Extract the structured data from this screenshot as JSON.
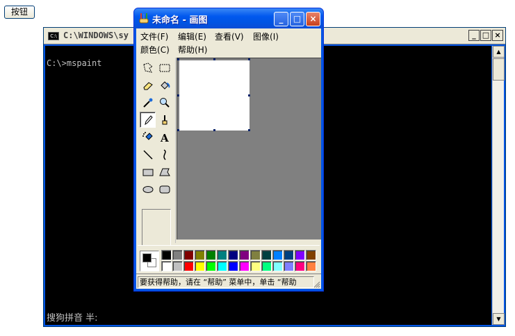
{
  "page_button": {
    "label": "按钮"
  },
  "console": {
    "title": "C:\\WINDOWS\\sy",
    "icon_label": "C:\\",
    "controls": [
      "_",
      "□",
      "×"
    ],
    "prompt_line": "C:\\>mspaint",
    "ime_status": "搜狗拼音 半:"
  },
  "paint": {
    "title": "未命名 - 画图",
    "controls": [
      "_",
      "□",
      "×"
    ],
    "menus": [
      {
        "label": "文件",
        "hotkey": "(F)"
      },
      {
        "label": "编辑",
        "hotkey": "(E)"
      },
      {
        "label": "查看",
        "hotkey": "(V)"
      },
      {
        "label": "图像",
        "hotkey": "(I)"
      },
      {
        "label": "颜色",
        "hotkey": "(C)"
      },
      {
        "label": "帮助",
        "hotkey": "(H)"
      }
    ],
    "tools": [
      "free-select-icon",
      "rect-select-icon",
      "eraser-icon",
      "fill-icon",
      "color-picker-icon",
      "magnifier-icon",
      "pencil-icon",
      "brush-icon",
      "airbrush-icon",
      "text-icon",
      "line-icon",
      "curve-icon",
      "rectangle-icon",
      "polygon-icon",
      "ellipse-icon",
      "rounded-rect-icon"
    ],
    "selected_tool": "pencil-icon",
    "foreground_color": "#000000",
    "background_color": "#ffffff",
    "palette_row1": [
      "#000000",
      "#808080",
      "#800000",
      "#808000",
      "#008000",
      "#008080",
      "#000080",
      "#800080",
      "#808040",
      "#004040",
      "#0080ff",
      "#004080",
      "#8000ff",
      "#804000"
    ],
    "palette_row2": [
      "#ffffff",
      "#c0c0c0",
      "#ff0000",
      "#ffff00",
      "#00ff00",
      "#00ffff",
      "#0000ff",
      "#ff00ff",
      "#ffff80",
      "#00ff80",
      "#80ffff",
      "#8080ff",
      "#ff0080",
      "#ff8040"
    ],
    "status_message": "要获得帮助，请在 “帮助” 菜单中，单击 “帮助"
  }
}
